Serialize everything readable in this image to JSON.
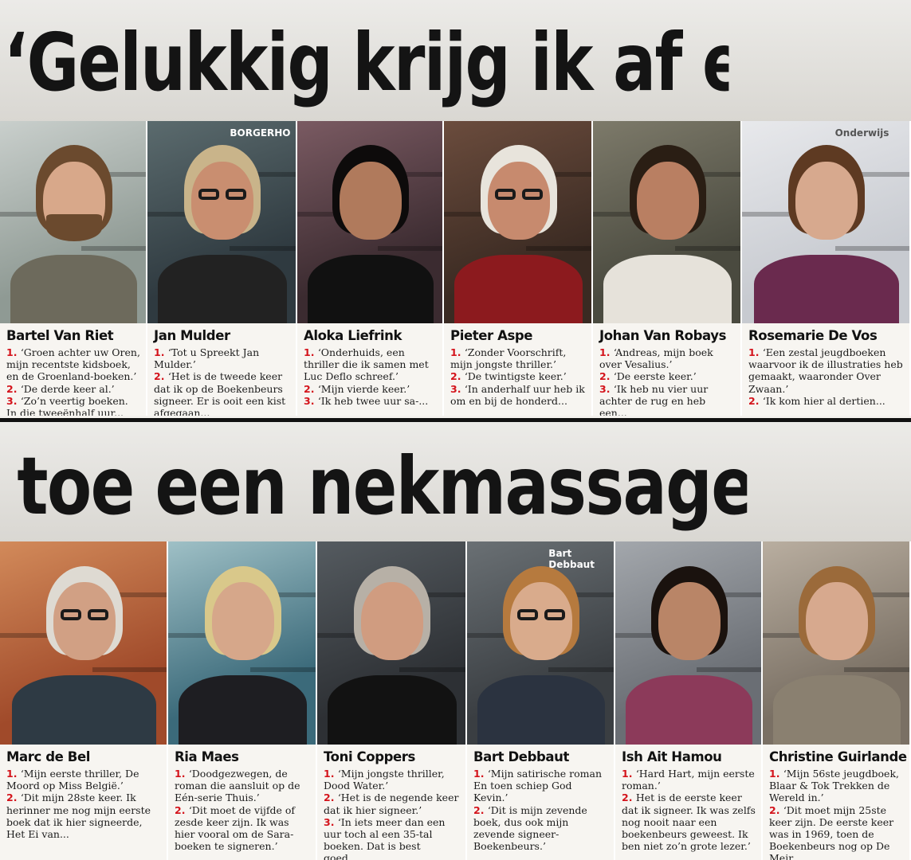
{
  "headline_top": "‘Gelukkig krijg ik af en",
  "headline_bottom": "toe een nekmassage’",
  "row1": [
    {
      "name": "Bartel Van Riet",
      "q": [
        [
          "1.",
          "‘Groen achter uw Oren, mijn recentste kidsboek, en de Groenland-boeken.’"
        ],
        [
          "2.",
          "‘De derde keer al.’"
        ],
        [
          "3.",
          "‘Zo’n veertig boeken. In die tweeënhalf uur..."
        ]
      ]
    },
    {
      "name": "Jan Mulder",
      "sign": "BORGERHO",
      "q": [
        [
          "1.",
          "‘Tot u Spreekt Jan Mulder.’"
        ],
        [
          "2.",
          "‘Het is de tweede keer dat ik op de Boekenbeurs signeer. Er is ooit een kist afgegaan..."
        ]
      ]
    },
    {
      "name": "Aloka Liefrink",
      "q": [
        [
          "1.",
          "‘Onderhuids, een thriller die ik samen met Luc Deflo schreef.’"
        ],
        [
          "2.",
          "‘Mijn vierde keer.’"
        ],
        [
          "3.",
          "‘Ik heb twee uur sa-..."
        ]
      ]
    },
    {
      "name": "Pieter Aspe",
      "q": [
        [
          "1.",
          "‘Zonder Voorschrift, mijn jongste thriller.’"
        ],
        [
          "2.",
          "‘De twintigste keer.’"
        ],
        [
          "3.",
          "‘In anderhalf uur heb ik om en bij de honderd..."
        ]
      ]
    },
    {
      "name": "Johan Van Robays",
      "q": [
        [
          "1.",
          "‘Andreas, mijn boek over Vesalius.’"
        ],
        [
          "2.",
          "‘De eerste keer.’"
        ],
        [
          "3.",
          "‘Ik heb nu vier uur achter de rug en heb een..."
        ]
      ]
    },
    {
      "name": "Rosemarie De Vos",
      "sign": "Onderwijs",
      "q": [
        [
          "1.",
          "‘Een zestal jeugdboeken waarvoor ik de illustraties heb gemaakt, waaronder Over Zwaan.’"
        ],
        [
          "2.",
          "‘Ik kom hier al dertien..."
        ]
      ]
    }
  ],
  "row2": [
    {
      "name": "Marc de Bel",
      "q": [
        [
          "1.",
          "‘Mijn eerste thriller, De Moord op Miss België.’"
        ],
        [
          "2.",
          "‘Dit mijn 28ste keer. Ik herinner me nog mijn eerste boek dat ik hier signeerde, Het Ei van..."
        ]
      ]
    },
    {
      "name": "Ria Maes",
      "q": [
        [
          "1.",
          "‘Doodgezwegen, de roman die aansluit op de Eén-serie Thuis.’"
        ],
        [
          "2.",
          "‘Dit moet de vijfde of zesde keer zijn. Ik was hier vooral om de Sara-boeken te signeren.’"
        ]
      ]
    },
    {
      "name": "Toni Coppers",
      "q": [
        [
          "1.",
          "‘Mijn jongste thriller, Dood Water.’"
        ],
        [
          "2.",
          "‘Het is de negende keer dat ik hier signeer.’"
        ],
        [
          "3.",
          "‘In iets meer dan een uur toch al een 35-tal boeken. Dat is best goed,..."
        ]
      ]
    },
    {
      "name": "Bart Debbaut",
      "sign": "Bart Debbaut",
      "q": [
        [
          "1.",
          "‘Mijn satirische roman En toen schiep God Kevin.’"
        ],
        [
          "2.",
          "‘Dit is mijn zevende boek, dus ook mijn zevende signeer-Boekenbeurs.’"
        ]
      ]
    },
    {
      "name": "Ish Ait Hamou",
      "q": [
        [
          "1.",
          "‘Hard Hart, mijn eerste roman.’"
        ],
        [
          "2.",
          "Het is de eerste keer dat ik signeer. Ik was zelfs nog nooit naar een boekenbeurs geweest. Ik ben niet zo’n grote lezer.’"
        ]
      ]
    },
    {
      "name": "Christine Guirlande",
      "q": [
        [
          "1.",
          "‘Mijn 56ste jeugdboek, Blaar & Tok Trekken de Wereld in.’"
        ],
        [
          "2.",
          "‘Dit moet mijn 25ste keer zijn. De eerste keer was in 1969, toen de Boekenbeurs nog op De Meir..."
        ]
      ]
    }
  ],
  "colors": {
    "accent": "#d4141c",
    "rule": "#111111"
  }
}
